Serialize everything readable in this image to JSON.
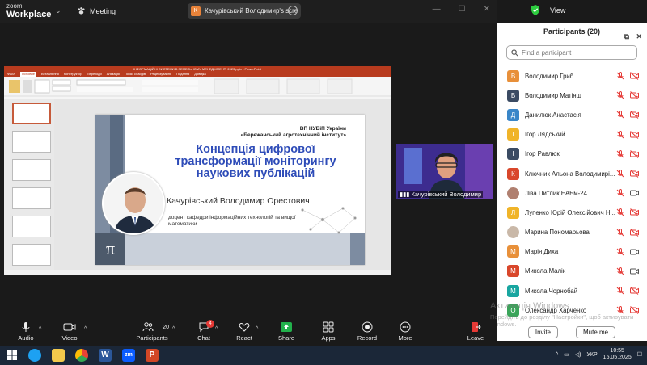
{
  "app": {
    "brand_line1": "zoom",
    "brand_line2": "Workplace",
    "meeting_label": "Meeting",
    "share_label": "Качурівський Володимир's scre",
    "share_avatar": "K",
    "view_label": "View"
  },
  "presentation": {
    "window_title": "ІНФОРМАЦІЙНІ СИСТЕМИ В ЗЕМЕЛЬНОМУ МЕНЕДЖМЕНТІ 2023.pptx - PowerPoint",
    "tabs": [
      "Файл",
      "Основне",
      "Вставлення",
      "Конструктор",
      "Переходи",
      "Анімація",
      "Показ слайдів",
      "Рецензування",
      "Подання",
      "Довідка"
    ],
    "active_tab": "Основне",
    "slide": {
      "org_line1": "ВП НУБіП України",
      "org_line2": "«Бережанський агротехнічний інститут»",
      "title": "Концепція цифрової трансформації моніторингу наукових публікацій",
      "name": "Качурівський Володимир Орестович",
      "position": "доцент кафедри інформаційних технологій та вищої математики",
      "pi": "π"
    }
  },
  "video": {
    "name": "Качурівський Володимир"
  },
  "participants": {
    "title": "Participants (20)",
    "search_placeholder": "Find a participant",
    "list": [
      {
        "initial": "В",
        "color": "#e8903a",
        "name": "Володимир  Гриб",
        "mic": "muted",
        "cam": "off"
      },
      {
        "initial": "В",
        "color": "#3b4b63",
        "name": "Володимир Матіяш",
        "mic": "muted",
        "cam": "off"
      },
      {
        "initial": "Д",
        "color": "#3a86c8",
        "name": "Данилюк Анастасія",
        "mic": "muted",
        "cam": "off"
      },
      {
        "initial": "І",
        "color": "#f0b429",
        "name": "Ігор Лядський",
        "mic": "muted",
        "cam": "off"
      },
      {
        "initial": "І",
        "color": "#3b4b63",
        "name": "Ігор Равлюк",
        "mic": "muted",
        "cam": "off"
      },
      {
        "initial": "К",
        "color": "#d9472b",
        "name": "Ключник Альона Володимирі...",
        "mic": "muted",
        "cam": "off"
      },
      {
        "initial": "",
        "color": "#b08070",
        "name": "Ліза Питлик ЕАБм-24",
        "mic": "muted",
        "cam": "on"
      },
      {
        "initial": "Л",
        "color": "#f0b429",
        "name": "Лупенко Юрій Олексійович Н...",
        "mic": "muted",
        "cam": "off"
      },
      {
        "initial": "",
        "color": "#c9b8a8",
        "name": "Марина Пономарьова",
        "mic": "muted",
        "cam": "off"
      },
      {
        "initial": "М",
        "color": "#e8903a",
        "name": "Марія Диха",
        "mic": "muted",
        "cam": "on"
      },
      {
        "initial": "М",
        "color": "#d9472b",
        "name": "Микола Малік",
        "mic": "muted",
        "cam": "on"
      },
      {
        "initial": "М",
        "color": "#19a6a0",
        "name": "Микола Чорнобай",
        "mic": "muted",
        "cam": "off"
      },
      {
        "initial": "О",
        "color": "#3aa55a",
        "name": "Олександр Харченко",
        "mic": "muted",
        "cam": "off"
      }
    ],
    "invite_label": "Invite",
    "mute_me_label": "Mute me",
    "watermark_line1": "Активація Windows",
    "watermark_line2": "Перейдіть до розділу \"Настройки\", щоб активувати Windows."
  },
  "toolbar": {
    "audio": "Audio",
    "video": "Video",
    "participants": "Participants",
    "participants_count": "20",
    "chat": "Chat",
    "chat_badge": "4",
    "react": "React",
    "share": "Share",
    "apps": "Apps",
    "record": "Record",
    "more": "More",
    "leave": "Leave"
  },
  "taskbar": {
    "lang": "УКР",
    "time": "10:55",
    "date": "15.05.2025"
  },
  "colors": {
    "zoom_blue": "#0b5cff",
    "share_green": "#22b14c",
    "muted_red": "#e53935",
    "slide_title_blue": "#2e4cb8"
  }
}
